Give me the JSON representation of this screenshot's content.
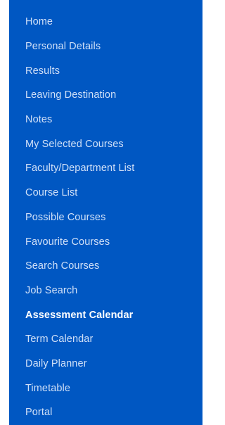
{
  "sidebar": {
    "background": "#0057c2",
    "text_color": "#cfe0f7",
    "active_text_color": "#ffffff",
    "active_index": 12,
    "items": [
      {
        "label": "Home"
      },
      {
        "label": "Personal Details"
      },
      {
        "label": "Results"
      },
      {
        "label": "Leaving Destination"
      },
      {
        "label": "Notes"
      },
      {
        "label": "My Selected Courses"
      },
      {
        "label": "Faculty/Department List"
      },
      {
        "label": "Course List"
      },
      {
        "label": "Possible Courses"
      },
      {
        "label": "Favourite Courses"
      },
      {
        "label": "Search Courses"
      },
      {
        "label": "Job Search"
      },
      {
        "label": "Assessment Calendar"
      },
      {
        "label": "Term Calendar"
      },
      {
        "label": "Daily Planner"
      },
      {
        "label": "Timetable"
      },
      {
        "label": "Portal"
      }
    ]
  }
}
